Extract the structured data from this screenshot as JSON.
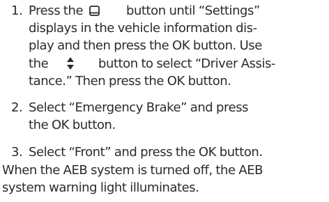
{
  "instructions": {
    "step1": {
      "number": "1.",
      "line1_before": "Press the",
      "line1_after": "button until “Settings”",
      "line2": "displays in the vehicle information dis-",
      "line3": "play and then press the OK button. Use",
      "line4_before": "the",
      "line4_after": "button to select “Driver Assis-",
      "line5": "tance.” Then press the OK button.",
      "icon_display": "display-button-icon",
      "icon_updown": "up-down-arrow-icon"
    },
    "step2": {
      "number": "2.",
      "line1": "Select “Emergency Brake” and press",
      "line2": "the OK button."
    },
    "step3": {
      "number": "3.",
      "line1": "Select “Front” and press the OK button."
    },
    "note": {
      "line1": "When the AEB system is turned off, the AEB",
      "line2": "system warning light illuminates."
    }
  }
}
